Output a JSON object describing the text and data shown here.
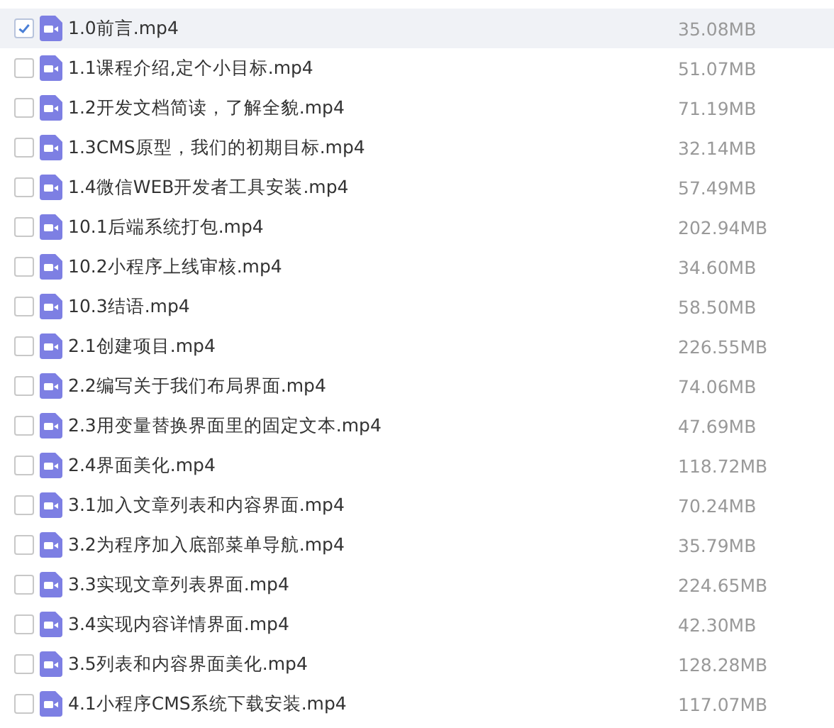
{
  "files": [
    {
      "name": "1.0前言.mp4",
      "size": "35.08MB",
      "selected": true
    },
    {
      "name": "1.1课程介绍,定个小目标.mp4",
      "size": "51.07MB",
      "selected": false
    },
    {
      "name": "1.2开发文档简读，了解全貌.mp4",
      "size": "71.19MB",
      "selected": false
    },
    {
      "name": "1.3CMS原型，我们的初期目标.mp4",
      "size": "32.14MB",
      "selected": false
    },
    {
      "name": "1.4微信WEB开发者工具安装.mp4",
      "size": "57.49MB",
      "selected": false
    },
    {
      "name": "10.1后端系统打包.mp4",
      "size": "202.94MB",
      "selected": false
    },
    {
      "name": "10.2小程序上线审核.mp4",
      "size": "34.60MB",
      "selected": false
    },
    {
      "name": "10.3结语.mp4",
      "size": "58.50MB",
      "selected": false
    },
    {
      "name": "2.1创建项目.mp4",
      "size": "226.55MB",
      "selected": false
    },
    {
      "name": "2.2编写关于我们布局界面.mp4",
      "size": "74.06MB",
      "selected": false
    },
    {
      "name": "2.3用变量替换界面里的固定文本.mp4",
      "size": "47.69MB",
      "selected": false
    },
    {
      "name": "2.4界面美化.mp4",
      "size": "118.72MB",
      "selected": false
    },
    {
      "name": "3.1加入文章列表和内容界面.mp4",
      "size": "70.24MB",
      "selected": false
    },
    {
      "name": "3.2为程序加入底部菜单导航.mp4",
      "size": "35.79MB",
      "selected": false
    },
    {
      "name": "3.3实现文章列表界面.mp4",
      "size": "224.65MB",
      "selected": false
    },
    {
      "name": "3.4实现内容详情界面.mp4",
      "size": "42.30MB",
      "selected": false
    },
    {
      "name": "3.5列表和内容界面美化.mp4",
      "size": "128.28MB",
      "selected": false
    },
    {
      "name": "4.1小程序CMS系统下载安装.mp4",
      "size": "117.07MB",
      "selected": false
    }
  ]
}
